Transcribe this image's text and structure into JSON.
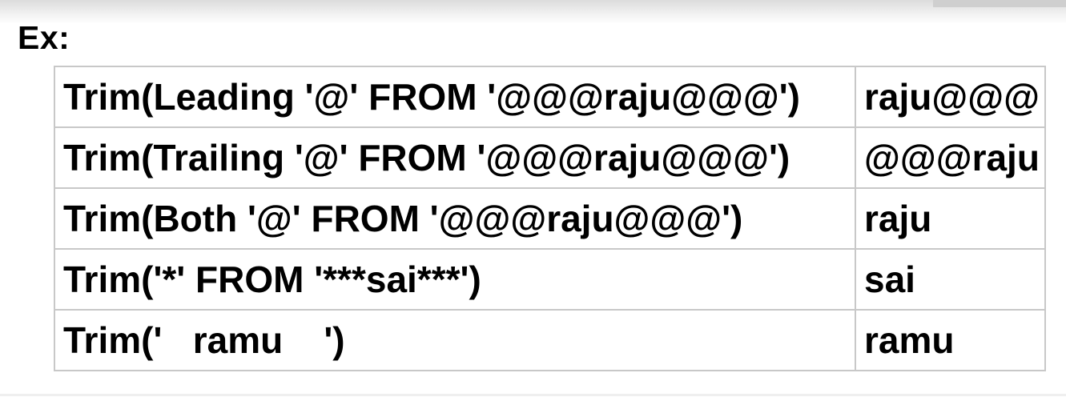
{
  "heading": "Ex:",
  "rows": [
    {
      "expression": "Trim(Leading '@' FROM '@@@raju@@@')",
      "result": "raju@@@"
    },
    {
      "expression": "Trim(Trailing '@' FROM '@@@raju@@@')",
      "result": "@@@raju"
    },
    {
      "expression": "Trim(Both '@' FROM '@@@raju@@@')",
      "result": "raju"
    },
    {
      "expression": "Trim('*' FROM '***sai***')",
      "result": "sai"
    },
    {
      "expression": "Trim('   ramu    ')",
      "result": "ramu"
    }
  ]
}
